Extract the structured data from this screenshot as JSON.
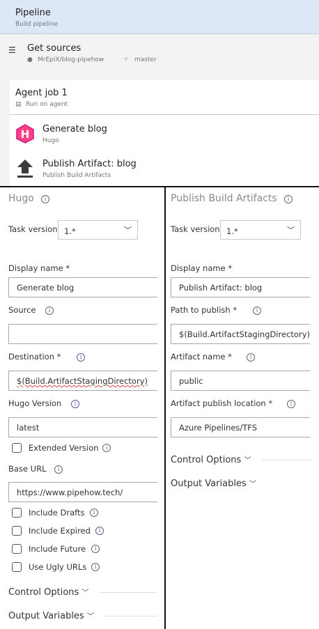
{
  "header": {
    "title": "Pipeline",
    "subtitle": "Build pipeline"
  },
  "sources": {
    "title": "Get sources",
    "repo": "MrEpiX/blog-pipehow",
    "branch": "master"
  },
  "job": {
    "title": "Agent job 1",
    "subtitle": "Run on agent",
    "tasks": [
      {
        "title": "Generate blog",
        "subtitle": "Hugo",
        "icon": "hugo-icon"
      },
      {
        "title": "Publish Artifact: blog",
        "subtitle": "Publish Build Artifacts",
        "icon": "upload-icon"
      }
    ]
  },
  "left": {
    "title": "Hugo",
    "task_version_label": "Task version",
    "task_version": "1.*",
    "display_name_label": "Display name *",
    "display_name": "Generate blog",
    "source_label": "Source",
    "source": "",
    "destination_label": "Destination *",
    "destination": "$(Build.ArtifactStagingDirectory)",
    "hugo_version_label": "Hugo Version",
    "hugo_version": "latest",
    "extended_label": "Extended Version",
    "base_url_label": "Base URL",
    "base_url": "https://www.pipehow.tech/",
    "checkboxes": [
      "Include Drafts",
      "Include Expired",
      "Include Future",
      "Use Ugly URLs"
    ],
    "control_options": "Control Options",
    "output_variables": "Output Variables"
  },
  "right": {
    "title": "Publish Build Artifacts",
    "task_version_label": "Task version",
    "task_version": "1.*",
    "display_name_label": "Display name *",
    "display_name": "Publish Artifact: blog",
    "path_label": "Path to publish *",
    "path": "$(Build.ArtifactStagingDirectory)",
    "artifact_name_label": "Artifact name *",
    "artifact_name": "public",
    "location_label": "Artifact publish location *",
    "location": "Azure Pipelines/TFS",
    "control_options": "Control Options",
    "output_variables": "Output Variables"
  },
  "colors": {
    "header_bg": "#dde8f6",
    "hugo": "#ff4088"
  }
}
